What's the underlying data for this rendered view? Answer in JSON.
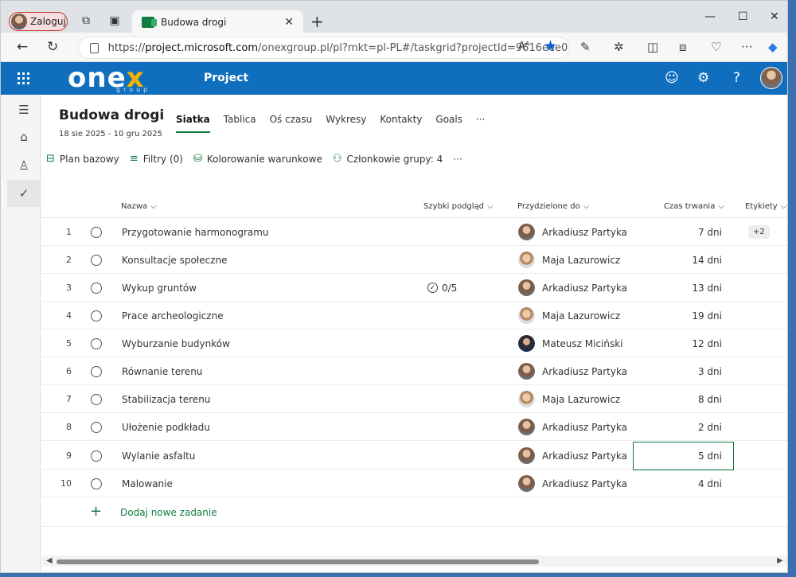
{
  "browser": {
    "profile_label": "Zaloguj",
    "tab_title": "Budowa drogi",
    "url_prefix": "https://",
    "url_host": "project.microsoft.com",
    "url_rest": "/onexgroup.pl/pl?mkt=pl-PL#/taskgrid?projectId=9616eee0-...",
    "reader_label": "Aᴬ"
  },
  "app": {
    "logo_main": "one",
    "logo_x": "x",
    "logo_sub": "group",
    "name": "Project"
  },
  "project": {
    "title": "Budowa drogi",
    "dates": "18 sie 2025 - 10 gru 2025"
  },
  "tabs": [
    "Siatka",
    "Tablica",
    "Oś czasu",
    "Wykresy",
    "Kontakty",
    "Goals"
  ],
  "tabs_more": "···",
  "toolbar": {
    "baseline": "Plan bazowy",
    "filters": "Filtry (0)",
    "conditional": "Kolorowanie warunkowe",
    "members": "Członkowie grupy: 4",
    "more": "···"
  },
  "columns": {
    "name": "Nazwa",
    "quick": "Szybki podgląd",
    "assigned": "Przydzielone do",
    "duration": "Czas trwania",
    "labels": "Etykiety"
  },
  "rows": [
    {
      "num": "1",
      "name": "Przygotowanie harmonogramu",
      "quick": "",
      "person": "Arkadiusz Partyka",
      "duration": "7 dni",
      "label": "+2"
    },
    {
      "num": "2",
      "name": "Konsultacje społeczne",
      "quick": "",
      "person": "Maja Lazurowicz",
      "duration": "14 dni",
      "label": ""
    },
    {
      "num": "3",
      "name": "Wykup gruntów",
      "quick": "0/5",
      "person": "Arkadiusz Partyka",
      "duration": "13 dni",
      "label": ""
    },
    {
      "num": "4",
      "name": "Prace archeologiczne",
      "quick": "",
      "person": "Maja Lazurowicz",
      "duration": "19 dni",
      "label": ""
    },
    {
      "num": "5",
      "name": "Wyburzanie budynków",
      "quick": "",
      "person": "Mateusz Miciński",
      "duration": "12 dni",
      "label": ""
    },
    {
      "num": "6",
      "name": "Równanie terenu",
      "quick": "",
      "person": "Arkadiusz Partyka",
      "duration": "3 dni",
      "label": ""
    },
    {
      "num": "7",
      "name": "Stabilizacja terenu",
      "quick": "",
      "person": "Maja Lazurowicz",
      "duration": "8 dni",
      "label": ""
    },
    {
      "num": "8",
      "name": "Ułożenie podkładu",
      "quick": "",
      "person": "Arkadiusz Partyka",
      "duration": "2 dni",
      "label": ""
    },
    {
      "num": "9",
      "name": "Wylanie asfaltu",
      "quick": "",
      "person": "Arkadiusz Partyka",
      "duration": "5 dni",
      "label": ""
    },
    {
      "num": "10",
      "name": "Malowanie",
      "quick": "",
      "person": "Arkadiusz Partyka",
      "duration": "4 dni",
      "label": ""
    }
  ],
  "add_task_label": "Dodaj nowe zadanie",
  "colors": {
    "header_blue": "#106ebe",
    "accent_green": "#107c41",
    "logo_yellow": "#f5b400"
  }
}
